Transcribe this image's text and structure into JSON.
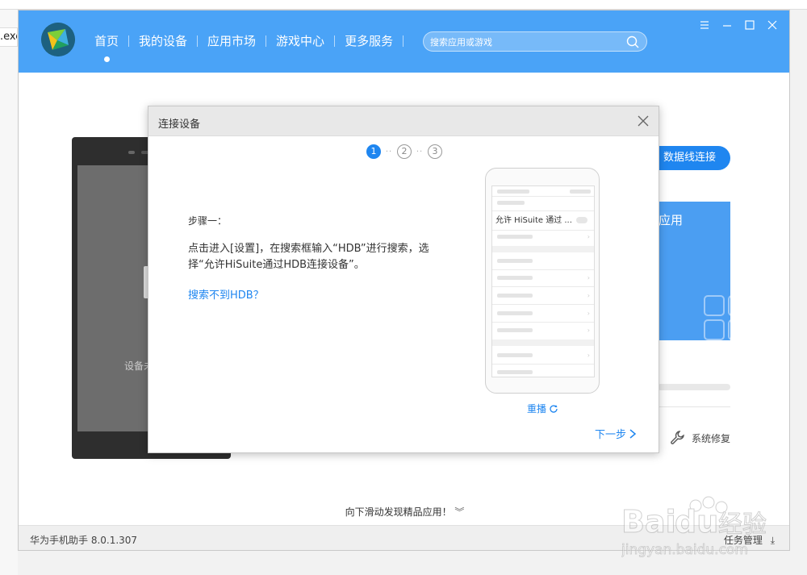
{
  "background": {
    "left_tab_text": ".exe"
  },
  "header": {
    "nav": [
      {
        "label": "首页"
      },
      {
        "label": "我的设备"
      },
      {
        "label": "应用市场"
      },
      {
        "label": "游戏中心"
      },
      {
        "label": "更多服务"
      }
    ],
    "search_placeholder": "搜索应用或游戏",
    "accent_color": "#4aa3f7"
  },
  "main": {
    "device_text": "设备未",
    "usb_button_label": "数据线连接",
    "app_card_title": "应用",
    "repair_label": "系统修复",
    "scroll_hint": "向下滑动发现精品应用！"
  },
  "footer": {
    "version": "华为手机助手 8.0.1.307",
    "task_manager": "任务管理"
  },
  "dialog": {
    "title": "连接设备",
    "steps": [
      "1",
      "2",
      "3"
    ],
    "step_title": "步骤一：",
    "step_desc": "点击进入[设置]，在搜索框输入“HDB”进行搜索，选择“允许HiSuite通过HDB连接设备”。",
    "help_link": "搜索不到HDB？",
    "mock_item": "允许 HiSuite 通过 ...",
    "replay_label": "重播",
    "next_label": "下一步"
  },
  "watermark": {
    "brand": "Bai",
    "brand2": "du",
    "cn": "经验",
    "url": "jingyan.baidu.com"
  }
}
